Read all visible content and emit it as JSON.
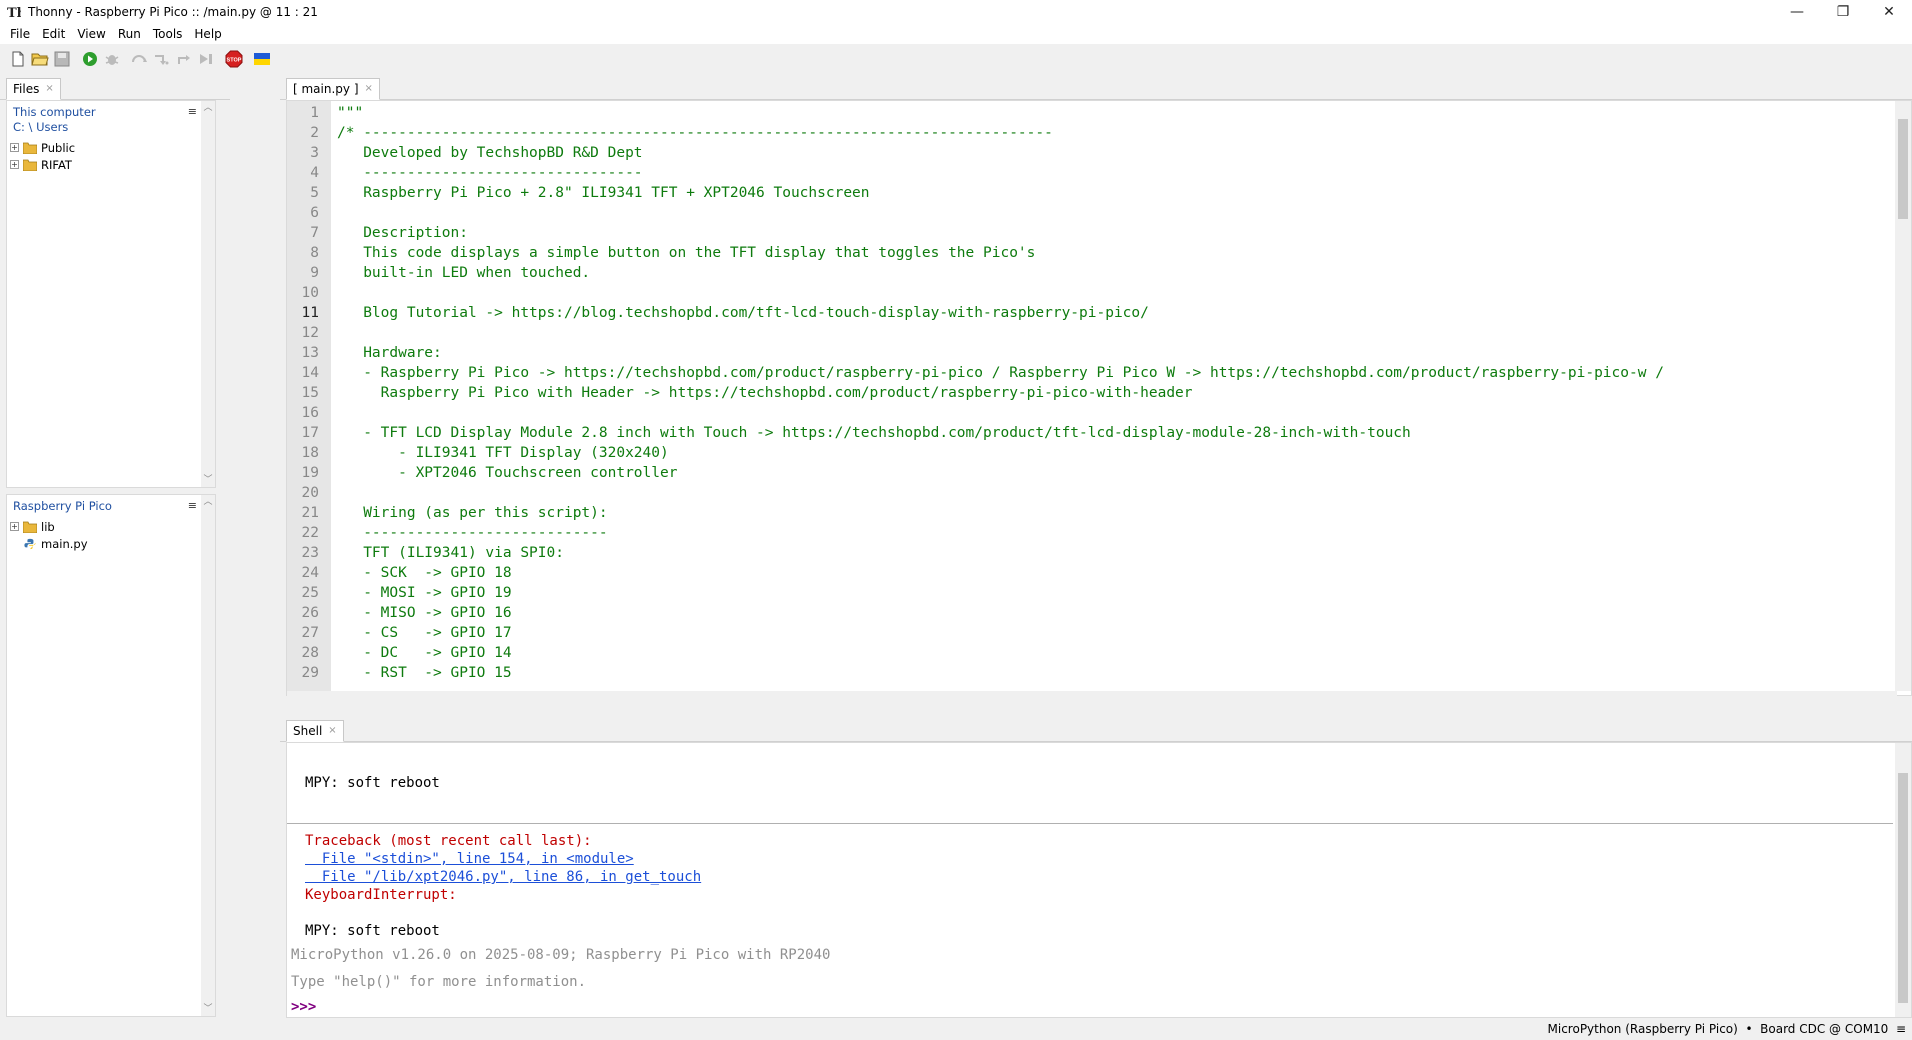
{
  "window": {
    "title": "Thonny  -  Raspberry Pi Pico :: /main.py  @  11 : 21",
    "minimize": "—",
    "restore": "❐",
    "close": "✕"
  },
  "menu": [
    "File",
    "Edit",
    "View",
    "Run",
    "Tools",
    "Help"
  ],
  "files_tab": {
    "label": "Files",
    "close": "×"
  },
  "local_files": {
    "header": "This computer",
    "path": "C: \\ Users",
    "items": [
      {
        "name": "Public",
        "expandable": true
      },
      {
        "name": "RIFAT",
        "expandable": true
      }
    ],
    "menu_icon": "≡"
  },
  "device_files": {
    "header": "Raspberry Pi Pico",
    "items": [
      {
        "name": "lib",
        "expandable": true,
        "type": "folder"
      },
      {
        "name": "main.py",
        "expandable": false,
        "type": "python-file"
      }
    ],
    "menu_icon": "≡"
  },
  "editor_tab": {
    "label": "[ main.py ]",
    "close": "×"
  },
  "editor": {
    "current_line": 11,
    "lines": [
      "\"\"\"",
      "/* -------------------------------------------------------------------------------",
      "   Developed by TechshopBD R&D Dept",
      "   --------------------------------",
      "   Raspberry Pi Pico + 2.8\" ILI9341 TFT + XPT2046 Touchscreen",
      "",
      "   Description:",
      "   This code displays a simple button on the TFT display that toggles the Pico's",
      "   built-in LED when touched.",
      "",
      "   Blog Tutorial -> https://blog.techshopbd.com/tft-lcd-touch-display-with-raspberry-pi-pico/",
      "",
      "   Hardware:",
      "   - Raspberry Pi Pico -> https://techshopbd.com/product/raspberry-pi-pico / Raspberry Pi Pico W -> https://techshopbd.com/product/raspberry-pi-pico-w /",
      "     Raspberry Pi Pico with Header -> https://techshopbd.com/product/raspberry-pi-pico-with-header",
      "",
      "   - TFT LCD Display Module 2.8 inch with Touch -> https://techshopbd.com/product/tft-lcd-display-module-28-inch-with-touch",
      "       - ILI9341 TFT Display (320x240)",
      "       - XPT2046 Touchscreen controller",
      "",
      "   Wiring (as per this script):",
      "   ----------------------------",
      "   TFT (ILI9341) via SPI0:",
      "   - SCK  -> GPIO 18",
      "   - MOSI -> GPIO 19",
      "   - MISO -> GPIO 16",
      "   - CS   -> GPIO 17",
      "   - DC   -> GPIO 14",
      "   - RST  -> GPIO 15"
    ]
  },
  "shell_tab": {
    "label": "Shell",
    "close": "×"
  },
  "shell": {
    "lines": [
      {
        "text": "MPY: soft reboot",
        "style": "black"
      },
      {
        "text": "Traceback (most recent call last):",
        "style": "red"
      },
      {
        "text": "  File \"<stdin>\", line 154, in <module>",
        "style": "link"
      },
      {
        "text": "  File \"/lib/xpt2046.py\", line 86, in get_touch",
        "style": "link"
      },
      {
        "text": "KeyboardInterrupt:",
        "style": "red"
      },
      {
        "text": "MPY: soft reboot",
        "style": "black"
      },
      {
        "text": "MicroPython v1.26.0 on 2025-08-09; Raspberry Pi Pico with RP2040",
        "style": "gray"
      },
      {
        "text": "Type \"help()\" for more information.",
        "style": "gray"
      },
      {
        "text": ">>>",
        "style": "prompt"
      }
    ]
  },
  "status": "MicroPython (Raspberry Pi Pico)  •  Board CDC @ COM10  ≡",
  "toolbar": {
    "icons": [
      "new-file-icon",
      "open-file-icon",
      "save-file-icon",
      "run-icon",
      "debug-icon",
      "step-over-icon",
      "step-into-icon",
      "step-out-icon",
      "resume-icon",
      "stop-icon",
      "flag-icon"
    ],
    "stop_label": "STOP"
  },
  "colors": {
    "accent_blue": "#1f4fa0",
    "code_green": "#0e7b0e",
    "error_red": "#c00000",
    "link_blue": "#1c4fd8",
    "prompt_purple": "#800080",
    "run_green": "#2e9e2e",
    "stop_red": "#d62020"
  }
}
